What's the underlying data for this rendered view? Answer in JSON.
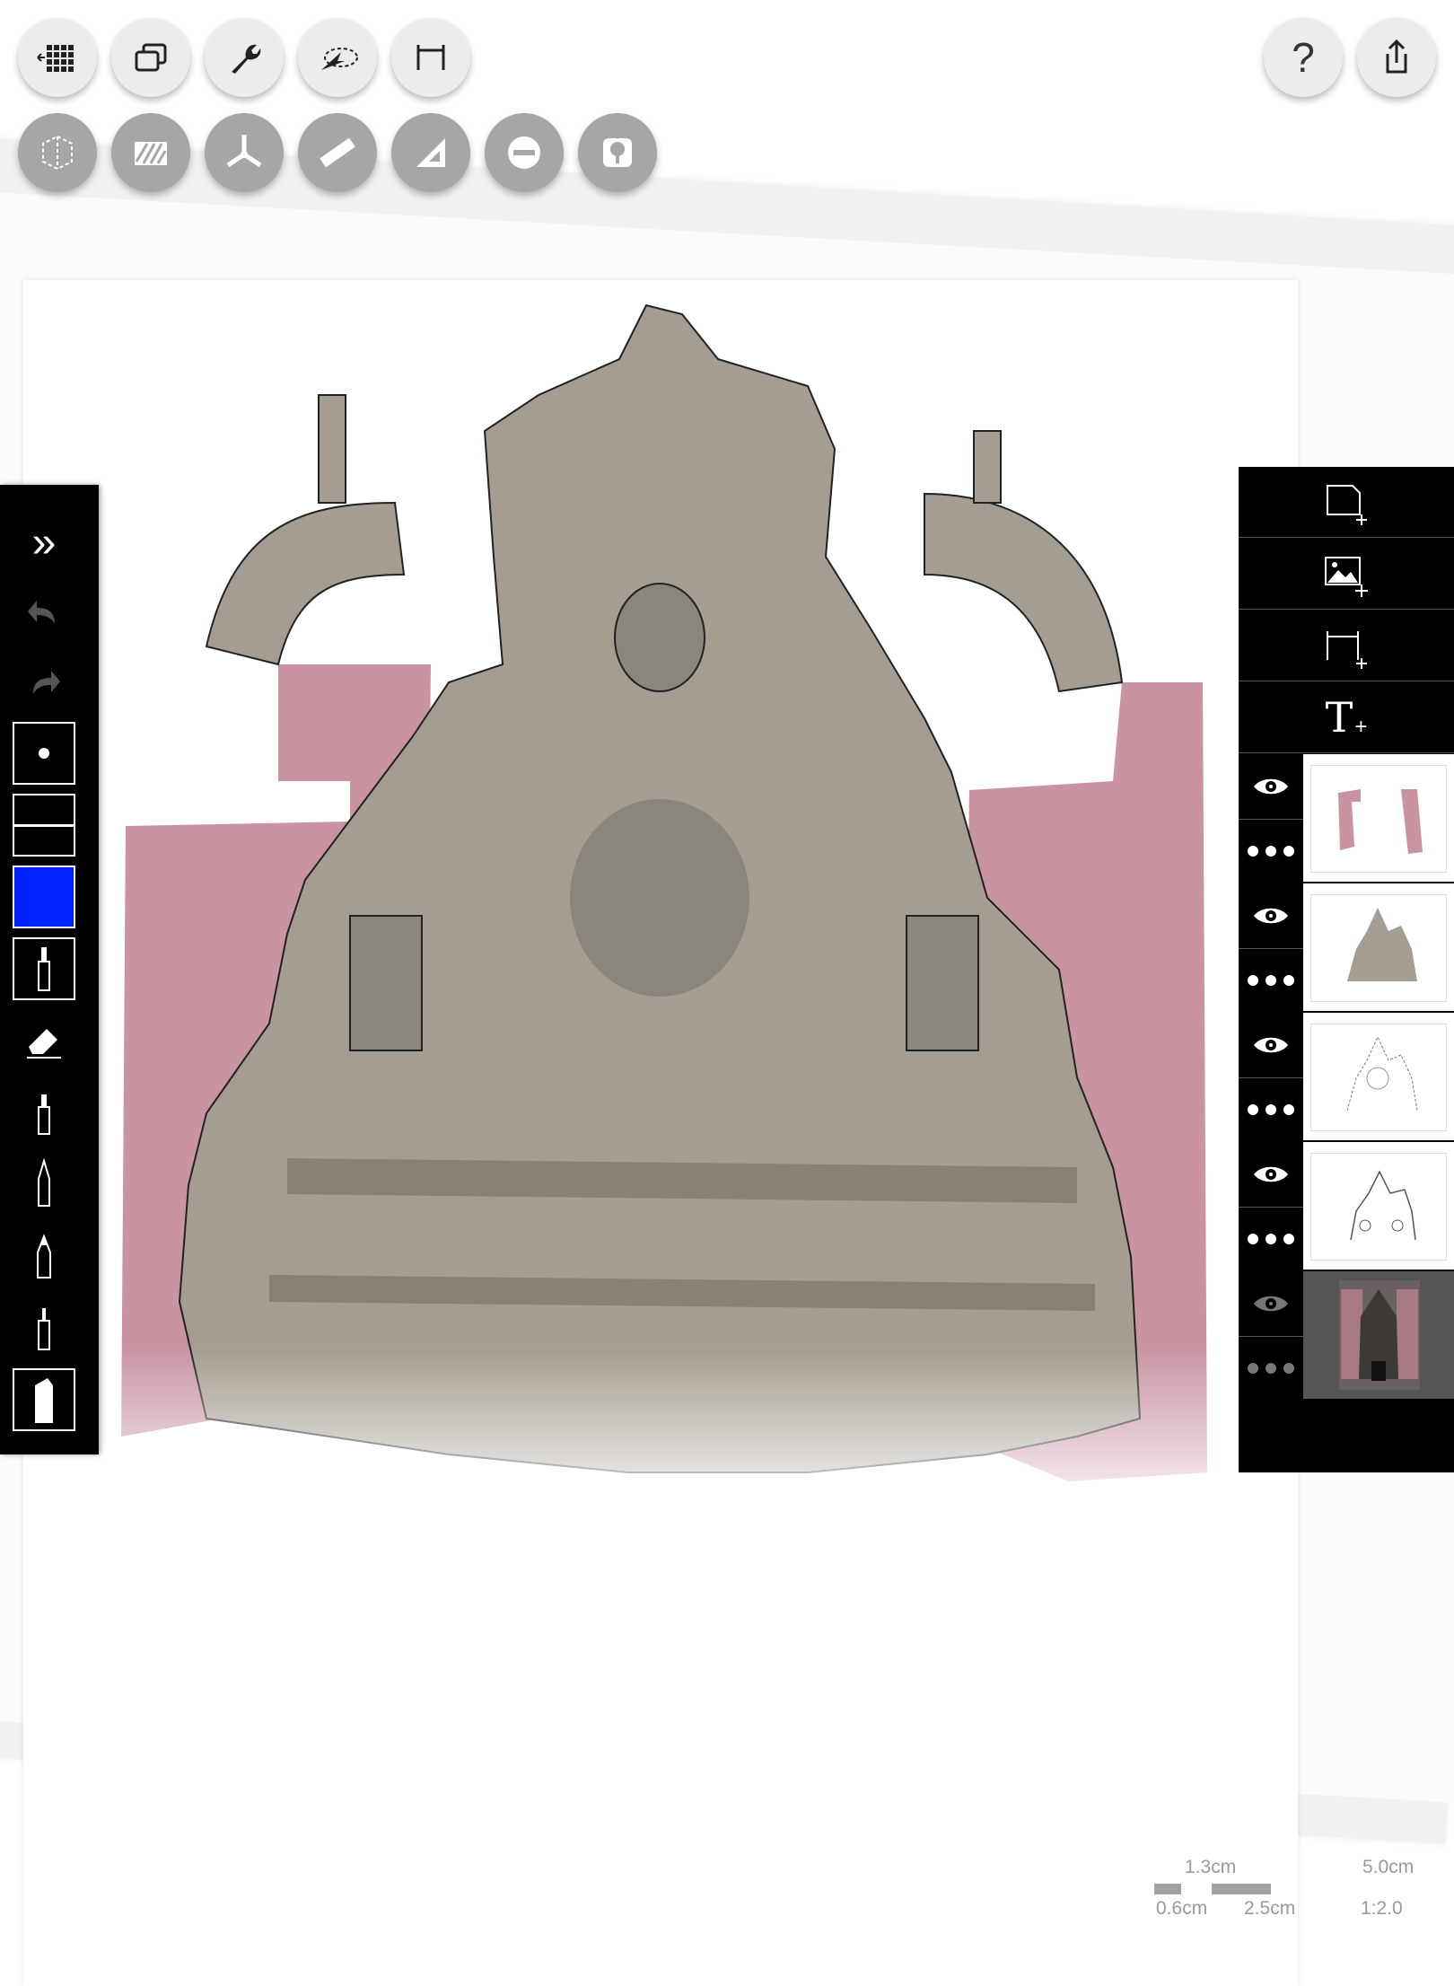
{
  "toolbar_top": [
    {
      "name": "grid-menu-icon"
    },
    {
      "name": "layers-copy-icon"
    },
    {
      "name": "wrench-icon"
    },
    {
      "name": "lasso-select-icon"
    },
    {
      "name": "dimension-icon"
    }
  ],
  "toolbar_second": [
    {
      "name": "perspective-cube-icon"
    },
    {
      "name": "hatch-fill-icon"
    },
    {
      "name": "axis-guide-icon"
    },
    {
      "name": "ruler-icon"
    },
    {
      "name": "set-square-icon"
    },
    {
      "name": "ellipse-guide-icon"
    },
    {
      "name": "tree-stamp-icon"
    }
  ],
  "toolbar_right": {
    "help_label": "?",
    "share_icon": "share-icon"
  },
  "left_palette": {
    "collapse_label": "»",
    "brush_color": "#0022ff",
    "tools": [
      "fineliner-tool",
      "eraser-tool",
      "pen-tool",
      "pencil-tool",
      "marker-tool",
      "fine-pen-tool",
      "chisel-marker-tool"
    ]
  },
  "right_panel": {
    "actions": [
      "new-layer-icon",
      "add-image-icon",
      "add-dimension-icon",
      "add-text-icon"
    ],
    "text_icon_label": "T",
    "layers": [
      {
        "name": "pink-fill-layer"
      },
      {
        "name": "stone-fill-layer"
      },
      {
        "name": "line-drawing-layer"
      },
      {
        "name": "sketch-layer"
      },
      {
        "name": "photo-reference-layer"
      }
    ]
  },
  "scale": {
    "top_left": "1.3cm",
    "top_right": "5.0cm",
    "bottom_left": "0.6cm",
    "bottom_mid": "2.5cm",
    "ratio": "1:2.0"
  },
  "colors": {
    "pink_wall": "#c993a2",
    "stone": "#a59d91",
    "stone_shadow": "#7f7a72"
  }
}
